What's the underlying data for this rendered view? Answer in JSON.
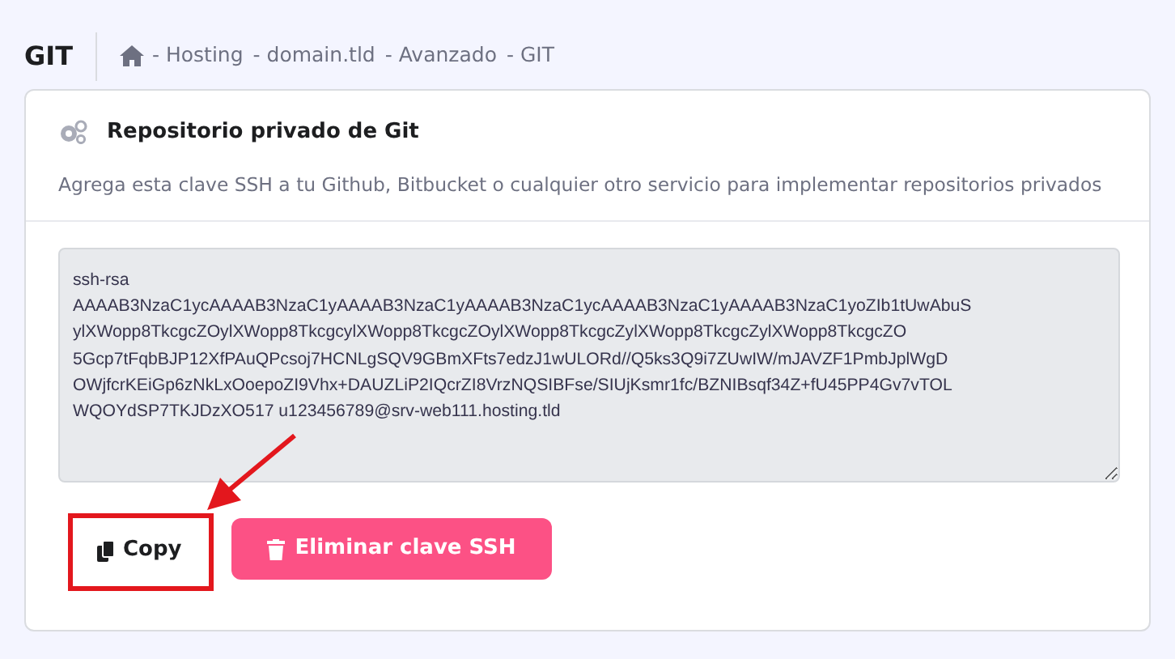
{
  "page_title": "GIT",
  "breadcrumb": [
    "- Hosting",
    "- domain.tld",
    "- Avanzado",
    "- GIT"
  ],
  "card": {
    "title": "Repositorio privado de Git",
    "description": "Agrega esta clave SSH a tu Github, Bitbucket o cualquier otro servicio para implementar repositorios privados",
    "ssh_key_lines": [
      "ssh-rsa",
      "AAAAB3NzaC1ycAAAAB3NzaC1yAAAAB3NzaC1yAAAAB3NzaC1ycAAAAB3NzaC1yAAAAB3NzaC1yoZIb1tUwAbuS",
      "ylXWopp8TkcgcZOylXWopp8TkcgcylXWopp8TkcgcZOylXWopp8TkcgcZylXWopp8TkcgcZylXWopp8TkcgcZO",
      "5Gcp7tFqbBJP12XfPAuQPcsoj7HCNLgSQV9GBmXFts7edzJ1wULORd//Q5ks3Q9i7ZUwIW/mJAVZF1PmbJplWgD",
      "OWjfcrKEiGp6zNkLxOoepoZI9Vhx+DAUZLiP2IQcrZI8VrzNQSIBFse/SIUjKsmr1fc/BZNIBsqf34Z+fU45PP4Gv7vTOL",
      "WQOYdSP7TKJDzXO517 u123456789@srv-web111.hosting.tld"
    ],
    "buttons": [
      {
        "kind": "copy",
        "label": "Copy",
        "highlighted": true
      },
      {
        "kind": "delete",
        "label": "Eliminar clave SSH",
        "highlighted": false
      }
    ]
  }
}
